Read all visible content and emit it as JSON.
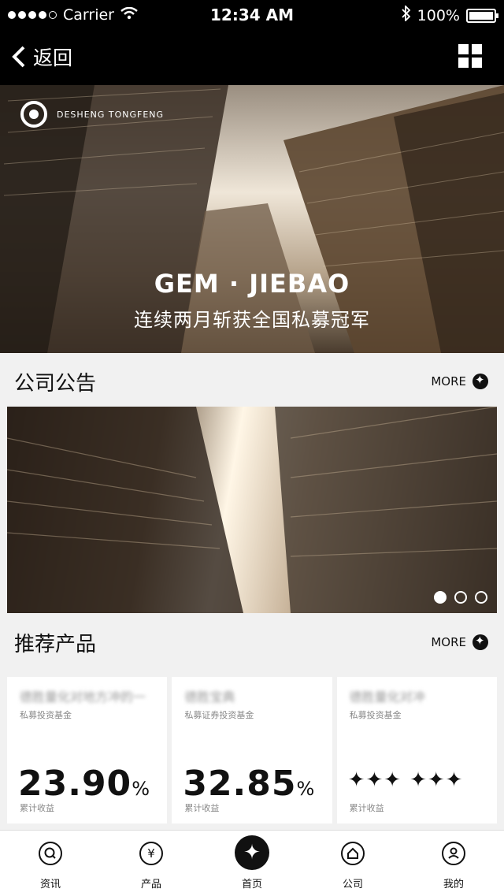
{
  "status_bar": {
    "carrier": "Carrier",
    "time": "12:34 AM",
    "battery": "100%"
  },
  "nav": {
    "back_label": "返回"
  },
  "hero": {
    "brand": "DESHENG  TONGFENG",
    "title": "GEM · JIEBAO",
    "subtitle": "连续两月斩获全国私募冠军"
  },
  "announcements": {
    "title": "公司公告",
    "more": "MORE"
  },
  "products": {
    "title": "推荐产品",
    "more": "MORE",
    "items": [
      {
        "name": "德胜量化对地方冲的一",
        "type": "私募投资基金",
        "value": "23.90",
        "unit": "%",
        "value_label": "累计收益"
      },
      {
        "name": "德胜宝典",
        "type": "私募证券投资基金",
        "value": "32.85",
        "unit": "%",
        "value_label": "累计收益"
      },
      {
        "name": "德胜量化对冲",
        "type": "私募投资基金",
        "value": "✦✦✦ ✦✦✦",
        "unit": "",
        "value_label": "累计收益"
      }
    ]
  },
  "tabs": [
    {
      "label": "资讯",
      "icon": "search-icon"
    },
    {
      "label": "产品",
      "icon": "yen-icon"
    },
    {
      "label": "首页",
      "icon": "home-logo-icon"
    },
    {
      "label": "公司",
      "icon": "house-icon"
    },
    {
      "label": "我的",
      "icon": "user-icon"
    }
  ],
  "colors": {
    "bar": "#000000",
    "background": "#f1f1f1",
    "card": "#ffffff"
  }
}
